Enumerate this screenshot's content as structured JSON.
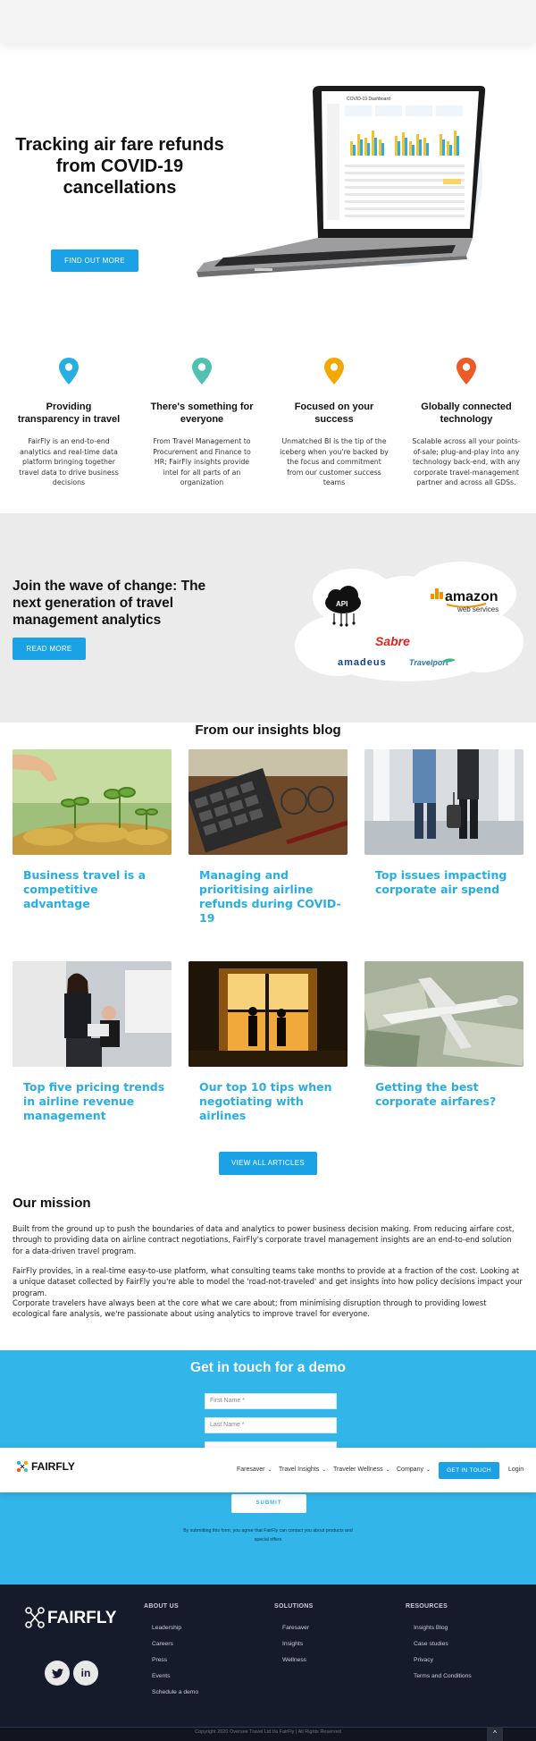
{
  "hero": {
    "title": "Tracking air fare refunds from COVID-19 cancellations",
    "button": "FIND OUT MORE",
    "screen_title": "COVID-19 Dashboard"
  },
  "features": [
    {
      "icon": "map-pin-icon",
      "color": "#29aee3",
      "title": "Providing transparency in travel",
      "text": "FairFly is an end-to-end analytics and real-time data platform bringing together travel data to drive business decisions"
    },
    {
      "icon": "map-pin-icon",
      "color": "#52c0b0",
      "title": "There's something for everyone",
      "text": "From Travel Management to Procurement and Finance to HR; FairFly insights provide intel for all parts of an organization"
    },
    {
      "icon": "map-pin-icon",
      "color": "#f2a800",
      "title": "Focused on your success",
      "text": "Unmatched BI is the tip of the iceberg when you're backed by the focus and commitment from our customer success teams"
    },
    {
      "icon": "map-pin-icon",
      "color": "#ee5a24",
      "title": "Globally connected technology",
      "text": "Scalable across all your points-of-sale; plug-and-play into any technology back-end, with any corporate travel-management partner and across all GDSs."
    }
  ],
  "wave": {
    "title": "Join the wave of change: The next generation of travel management analytics",
    "button": "READ MORE",
    "partners": {
      "api": "API",
      "amazon": "amazon",
      "amazon_sub": "web services",
      "sabre": "Sabre",
      "amadeus": "amadeus",
      "travelport": "Travelport"
    }
  },
  "blog": {
    "heading": "From our insights blog",
    "cards": [
      {
        "title": "Business travel is a competitive advantage"
      },
      {
        "title": "Managing and prioritising airline refunds during COVID-19"
      },
      {
        "title": "Top issues impacting corporate air spend"
      },
      {
        "title": "Top five pricing trends in airline revenue management"
      },
      {
        "title": "Our top 10 tips when negotiating with airlines"
      },
      {
        "title": "Getting the best corporate airfares?"
      }
    ],
    "view_all": "VIEW ALL ARTICLES"
  },
  "mission": {
    "title": "Our mission",
    "paragraphs": [
      "Built from the ground up to push the boundaries of data and analytics to power business decision making. From reducing airfare cost, through to providing data on airline contract negotiations, FairFly's corporate travel management insights are an end-to-end solution for a data-driven travel program.",
      "FairFly provides, in a real-time easy-to-use platform, what consulting teams take months to provide at a fraction of the cost. Looking at a unique dataset collected by FairFly you're able to model the 'road-not-traveled' and get insights into how policy decisions impact your program.",
      "Corporate travelers have always been at the core what we care about; from minimising disruption through to providing lowest ecological fare analysis, we're passionate about using analytics to improve travel for everyone."
    ]
  },
  "demo": {
    "title": "Get in touch for a demo",
    "first_name_placeholder": "First Name *",
    "last_name_placeholder": "Last Name *",
    "submit": "SUBMIT",
    "consent": "By submitting this form, you agree that FairFly can contact you about products and special offers"
  },
  "navbar": {
    "logo": "FAIRFLY",
    "items": [
      "Faresaver",
      "Travel Insights",
      "Traveler Wellness",
      "Company"
    ],
    "cta": "GET IN TOUCH",
    "login": "Login"
  },
  "footer": {
    "logo": "FAIRFLY",
    "columns": [
      {
        "heading": "ABOUT US",
        "links": [
          "Leadership",
          "Careers",
          "Press",
          "Events",
          "Schedule a demo"
        ]
      },
      {
        "heading": "SOLUTIONS",
        "links": [
          "Faresaver",
          "Insights",
          "Wellness"
        ]
      },
      {
        "heading": "RESOURCES",
        "links": [
          "Insights Blog",
          "Case studies",
          "Privacy",
          "Terms and Conditions"
        ]
      }
    ],
    "social": {
      "twitter": "twitter-icon",
      "linkedin": "linkedin-icon",
      "linkedin_text": "in"
    },
    "copyright": "Copyright 2020 Oversee Travel Ltd t/a FairFly | All Rights Reserved",
    "to_top": "^"
  },
  "colors": {
    "accent": "#1ba2e6",
    "demo_band": "#32b5e9",
    "footer": "#161b2b",
    "title_blue": "#29aee3"
  }
}
